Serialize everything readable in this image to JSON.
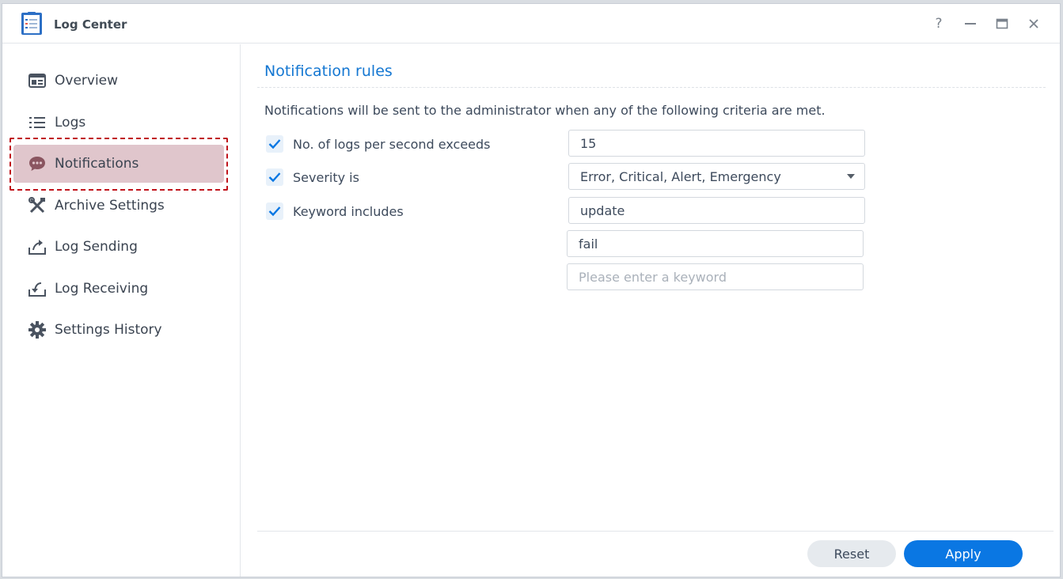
{
  "window": {
    "title": "Log Center"
  },
  "title_controls": {
    "help": "?",
    "minimize": "—",
    "maximize": "▭",
    "close": "✕"
  },
  "sidebar": {
    "items": [
      {
        "label": "Overview",
        "icon": "overview-icon"
      },
      {
        "label": "Logs",
        "icon": "list-icon"
      },
      {
        "label": "Notifications",
        "icon": "chat-bubble-icon",
        "active": true
      },
      {
        "label": "Archive Settings",
        "icon": "tools-icon"
      },
      {
        "label": "Log Sending",
        "icon": "upload-icon"
      },
      {
        "label": "Log Receiving",
        "icon": "download-icon"
      },
      {
        "label": "Settings History",
        "icon": "gear-icon"
      }
    ]
  },
  "main": {
    "section_title": "Notification rules",
    "description": "Notifications will be sent to the administrator when any of the following criteria are met.",
    "rules": {
      "logs_per_second": {
        "label": "No. of logs per second exceeds",
        "checked": true,
        "value": "15"
      },
      "severity": {
        "label": "Severity is",
        "checked": true,
        "value": "Error, Critical, Alert, Emergency"
      },
      "keyword": {
        "label": "Keyword includes",
        "checked": true,
        "values": [
          "update",
          "fail"
        ],
        "placeholder": "Please enter a keyword"
      }
    },
    "buttons": {
      "reset": "Reset",
      "apply": "Apply"
    }
  },
  "colors": {
    "accent": "#0a77e3",
    "title_blue": "#1477d2",
    "active_nav_bg": "#e0c6cc",
    "highlight_border": "#c0131b"
  }
}
